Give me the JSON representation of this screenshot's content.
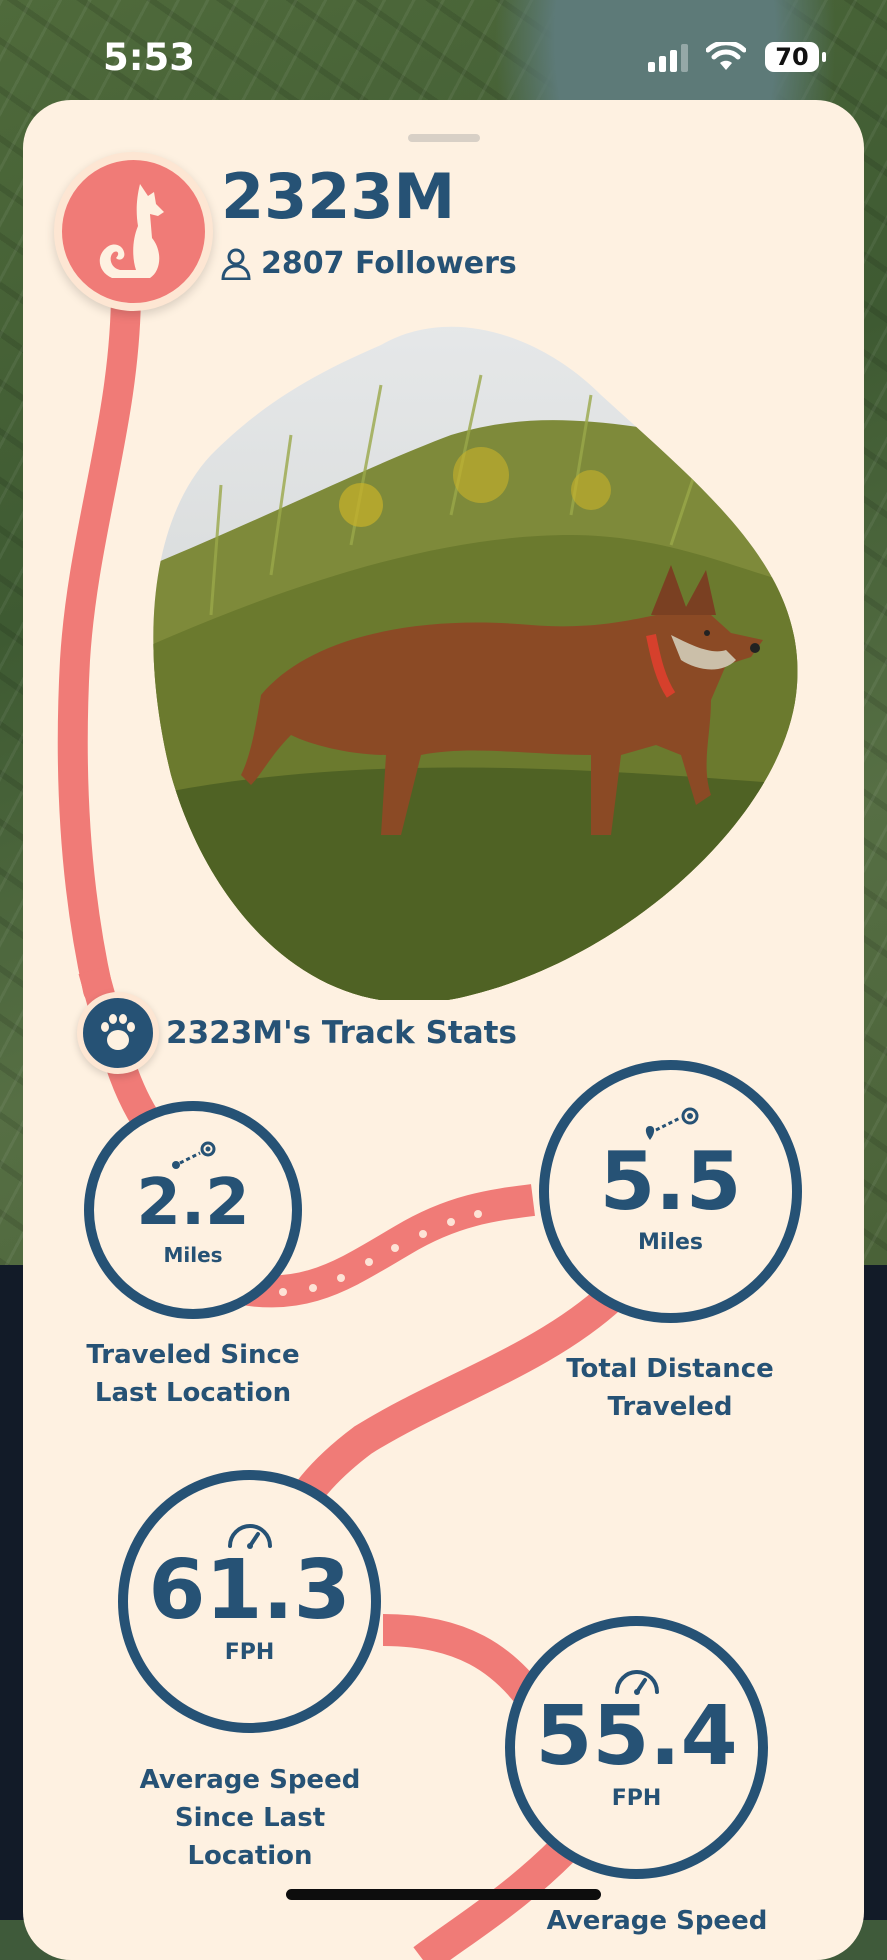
{
  "status_bar": {
    "time": "5:53",
    "battery": "70"
  },
  "profile": {
    "name": "2323M",
    "followers": "2807 Followers"
  },
  "track_stats": {
    "title": "2323M's Track Stats"
  },
  "stats": [
    {
      "value": "2.2",
      "unit": "Miles",
      "caption_line1": "Traveled Since",
      "caption_line2": "Last Location",
      "icon": "route-icon"
    },
    {
      "value": "5.5",
      "unit": "Miles",
      "caption_line1": "Total Distance",
      "caption_line2": "Traveled",
      "icon": "route-icon"
    },
    {
      "value": "61.3",
      "unit": "FPH",
      "caption_line1": "Average Speed",
      "caption_line2": "Since Last Location",
      "icon": "speedometer-icon"
    },
    {
      "value": "55.4",
      "unit": "FPH",
      "caption_line1": "Average Speed",
      "caption_line2": "",
      "icon": "speedometer-icon"
    }
  ],
  "colors": {
    "primary": "#265275",
    "accent": "#f07b77",
    "sheet_bg": "#fef1e1"
  }
}
